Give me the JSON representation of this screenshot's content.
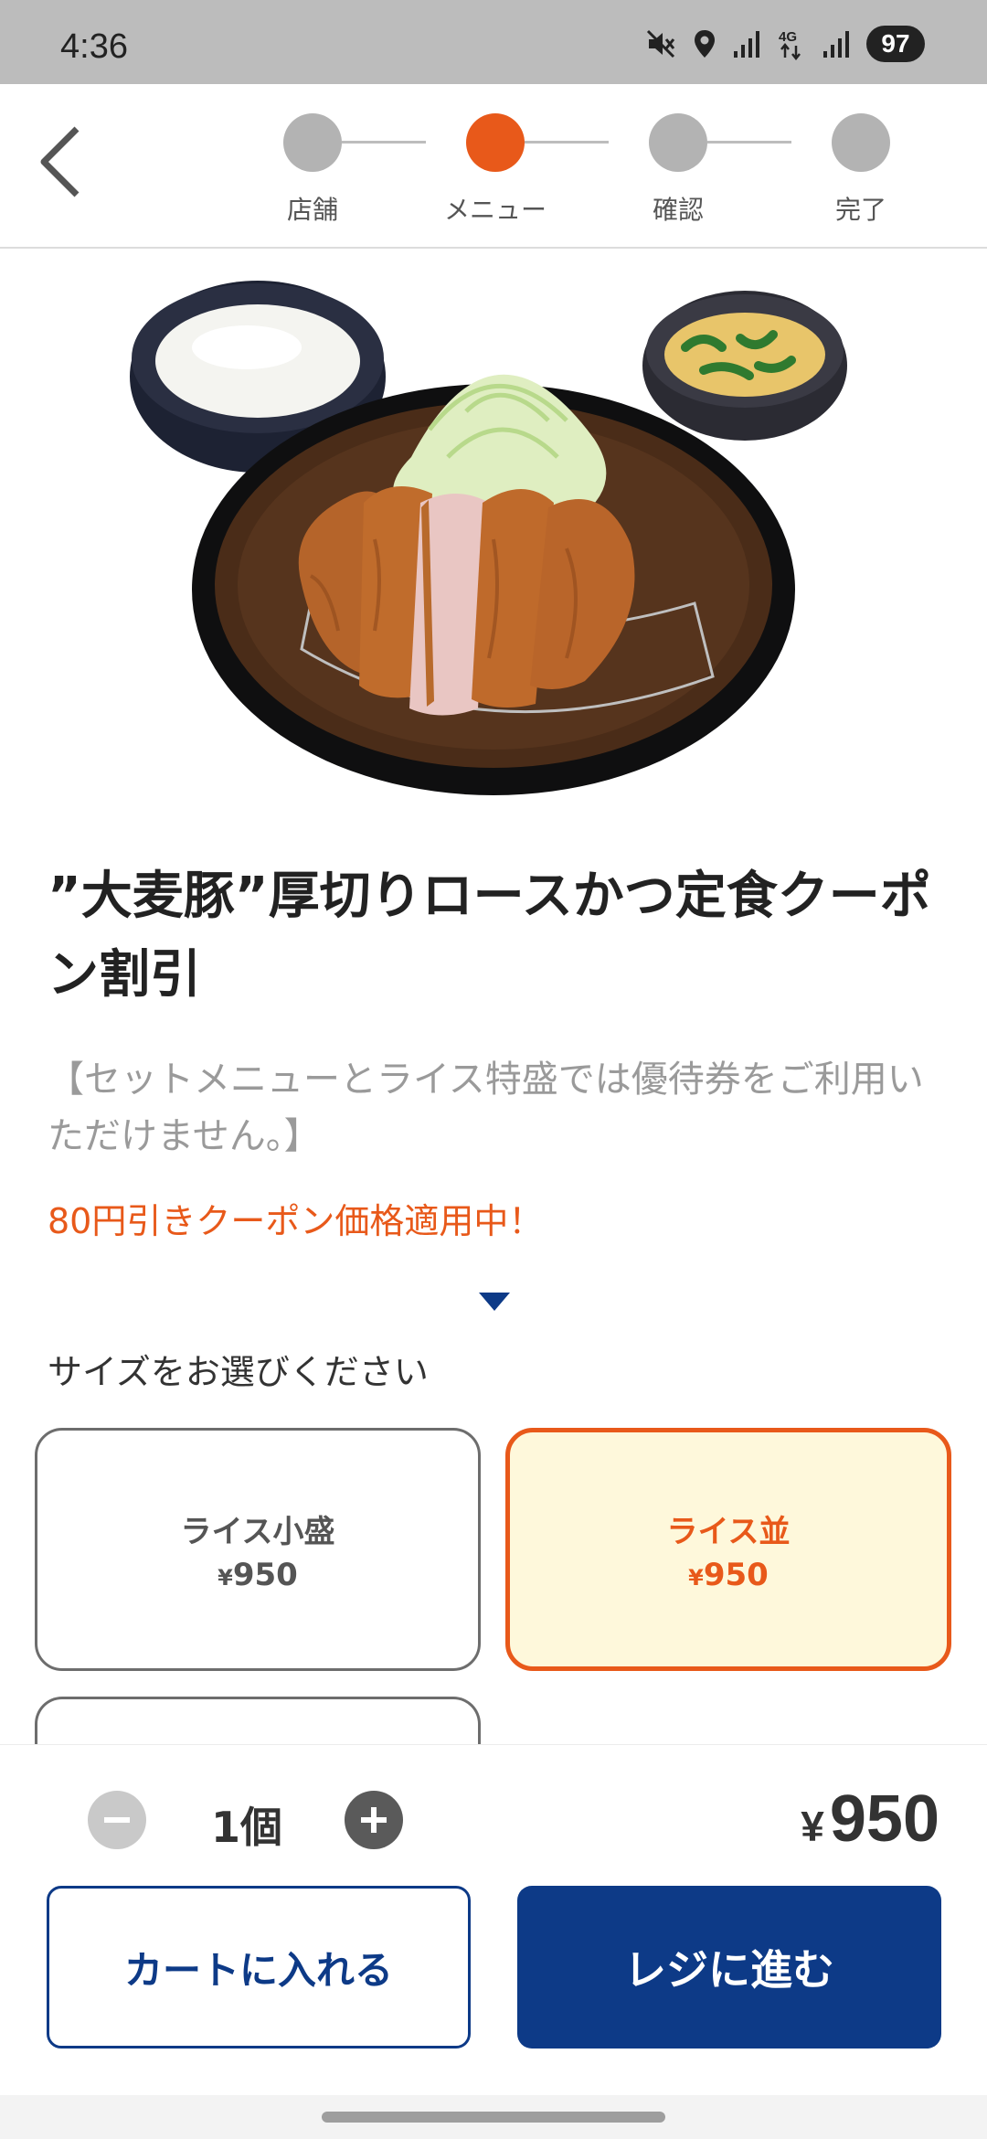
{
  "status_bar": {
    "time": "4:36",
    "battery": "97",
    "icons": [
      "mute-icon",
      "location-icon",
      "signal-icon",
      "4g-icon",
      "signal-icon"
    ]
  },
  "header": {
    "back_icon": "chevron-left-icon",
    "steps": [
      {
        "label": "店舗",
        "active": false
      },
      {
        "label": "メニュー",
        "active": true
      },
      {
        "label": "確認",
        "active": false
      },
      {
        "label": "完了",
        "active": false
      }
    ]
  },
  "product": {
    "image": "tonkatsu-set-meal",
    "title": "”大麦豚”厚切りロースかつ定食クーポン割引",
    "note": "【セットメニューとライス特盛では優待券をご利用いただけません。】",
    "coupon_notice": "80円引きクーポン価格適用中！"
  },
  "size": {
    "heading": "サイズをお選びください",
    "options": [
      {
        "name": "ライス小盛",
        "currency": "¥",
        "price": "950",
        "selected": false
      },
      {
        "name": "ライス並",
        "currency": "¥",
        "price": "950",
        "selected": true
      }
    ]
  },
  "order": {
    "quantity": "1個",
    "currency": "¥",
    "total": "950",
    "cart_label": "カートに入れる",
    "checkout_label": "レジに進む"
  },
  "colors": {
    "accent": "#e8591a",
    "brand": "#0d3a87",
    "selected_bg": "#fef8db"
  }
}
